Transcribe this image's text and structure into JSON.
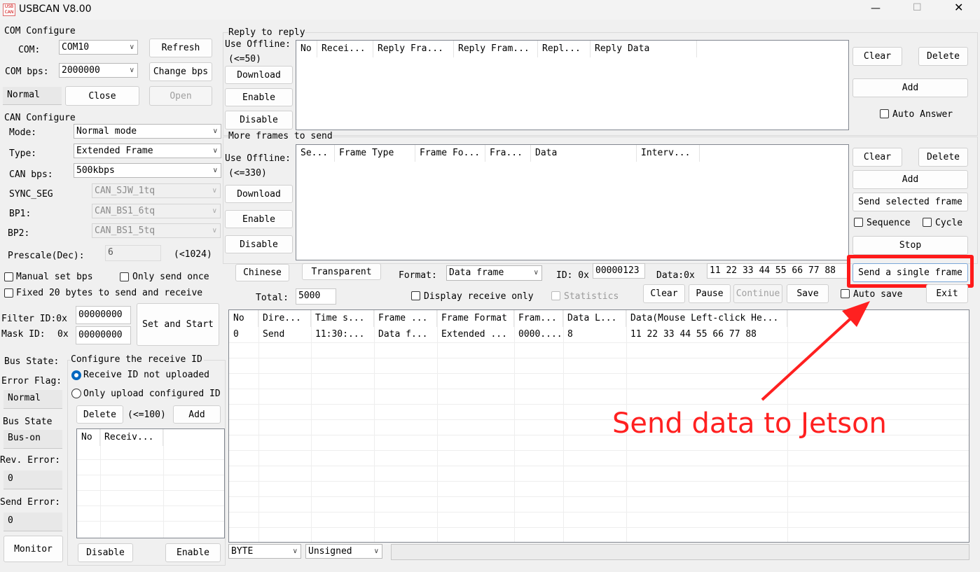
{
  "window": {
    "title": "USBCAN V8.00",
    "icon_text": "USB CAN",
    "minimize": "—",
    "maximize": "☐",
    "close": "✕"
  },
  "com": {
    "group_title": "COM Configure",
    "com_label": "COM:",
    "com_value": "COM10",
    "bps_label": "COM bps:",
    "bps_value": "2000000",
    "refresh": "Refresh",
    "change_bps": "Change bps",
    "status": "Normal",
    "close": "Close",
    "open": "Open"
  },
  "can": {
    "group_title": "CAN Configure",
    "mode_label": "Mode:",
    "mode_value": "Normal mode",
    "type_label": "Type:",
    "type_value": "Extended Frame",
    "bps_label": "CAN bps:",
    "bps_value": "500kbps",
    "sync_label": "SYNC_SEG",
    "sync_value": "CAN_SJW_1tq",
    "bp1_label": "BP1:",
    "bp1_value": "CAN_BS1_6tq",
    "bp2_label": "BP2:",
    "bp2_value": "CAN_BS1_5tq",
    "prescale_label": "Prescale(Dec):",
    "prescale_value": "6",
    "prescale_limit": "(<1024)",
    "manual_bps": "Manual set bps",
    "only_send_once": "Only send once",
    "fixed_20": "Fixed 20 bytes to send and receive",
    "filter_label": "Filter ID:0x",
    "filter_value": "00000000",
    "mask_label": "Mask ID:",
    "mask_prefix": "0x",
    "mask_value": "00000000",
    "set_and_start": "Set and Start"
  },
  "status_panel": {
    "bus_state_label": "Bus State:",
    "error_flag_label": "Error Flag:",
    "error_flag_value": "Normal",
    "bus_state2_label": "Bus State",
    "bus_state2_value": "Bus-on",
    "rev_error_label": "Rev. Error:",
    "rev_error_value": "0",
    "send_error_label": "Send Error:",
    "send_error_value": "0",
    "monitor": "Monitor"
  },
  "receive_id": {
    "group_title": "Configure the receive ID",
    "opt_not_uploaded": "Receive ID not uploaded",
    "opt_only_upload": "Only upload configured ID",
    "delete": "Delete",
    "limit": "(<=100)",
    "add": "Add",
    "columns": [
      "No",
      "Receiv..."
    ],
    "disable": "Disable",
    "enable": "Enable"
  },
  "reply": {
    "group_title": "Reply to reply",
    "use_offline": "Use Offline:",
    "limit": "(<=50)",
    "download": "Download",
    "enable": "Enable",
    "disable": "Disable",
    "columns": [
      "No",
      "Recei...",
      "Reply Fra...",
      "Reply Fram...",
      "Repl...",
      "Reply Data"
    ],
    "clear": "Clear",
    "delete": "Delete",
    "add": "Add",
    "auto_answer": "Auto Answer"
  },
  "more_frames": {
    "group_title": "More frames to send",
    "use_offline": "Use Offline:",
    "limit": "(<=330)",
    "download": "Download",
    "enable": "Enable",
    "disable": "Disable",
    "columns": [
      "Se...",
      "Frame Type",
      "Frame Fo...",
      "Fra...",
      "Data",
      "Interv..."
    ],
    "clear": "Clear",
    "delete": "Delete",
    "add": "Add",
    "send_selected": "Send selected frame",
    "sequence": "Sequence",
    "cycle": "Cycle",
    "stop": "Stop"
  },
  "send_bar": {
    "chinese": "Chinese",
    "transparent": "Transparent",
    "format_label": "Format:",
    "format_value": "Data frame",
    "id_label": "ID: 0x",
    "id_value": "00000123",
    "data_label": "Data:0x",
    "data_value": "11 22 33 44 55 66 77 88",
    "send_single": "Send a single frame",
    "total_label": "Total:",
    "total_value": "5000",
    "display_receive_only": "Display receive only",
    "statistics": "Statistics",
    "clear": "Clear",
    "pause": "Pause",
    "continue": "Continue",
    "save": "Save",
    "auto_save": "Auto save",
    "exit": "Exit"
  },
  "log": {
    "columns": [
      "No",
      "Dire...",
      "Time s...",
      "Frame ...",
      "Frame Format",
      "Fram...",
      "Data L...",
      "Data(Mouse Left-click He..."
    ],
    "rows": [
      [
        "0",
        "Send",
        "11:30:...",
        "Data f...",
        "Extended ...",
        "0000....",
        "8",
        "11 22 33 44 55 66 77 88"
      ]
    ]
  },
  "bottom": {
    "display_value": "BYTE",
    "sign_value": "Unsigned"
  },
  "annotation": {
    "text": "Send data to Jetson",
    "color": "#ff2020"
  }
}
